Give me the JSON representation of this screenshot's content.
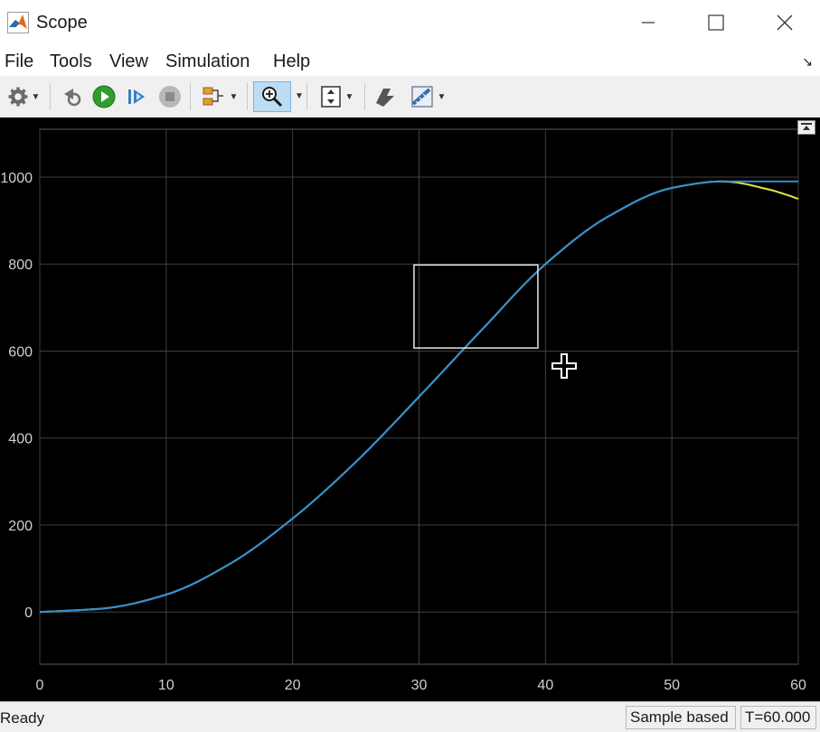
{
  "window": {
    "title": "Scope"
  },
  "menu": {
    "items": [
      "File",
      "Tools",
      "View",
      "Simulation",
      "Help"
    ]
  },
  "toolbar": {
    "icons": [
      "gear-icon",
      "step-back-icon",
      "run-icon",
      "step-forward-icon",
      "stop-icon",
      "signal-select-icon",
      "zoom-in-icon",
      "autoscale-icon",
      "highlight-icon",
      "measure-icon"
    ],
    "zoom_active": true
  },
  "status": {
    "left": "Ready",
    "mode": "Sample based",
    "time": "T=60.000"
  },
  "colors": {
    "plot_bg": "#000000",
    "grid": "#404040",
    "axis_text": "#d0d0d0",
    "series_blue": "#2f8fd8",
    "series_yellow": "#e2e24a",
    "zoom_box": "#d8d8d8"
  },
  "chart_data": {
    "type": "line",
    "title": "",
    "xlabel": "",
    "ylabel": "",
    "xlim": [
      0,
      60
    ],
    "ylim": [
      -120,
      1110
    ],
    "xticks": [
      0,
      10,
      20,
      30,
      40,
      50,
      60
    ],
    "yticks": [
      0,
      200,
      400,
      600,
      800,
      1000
    ],
    "grid": true,
    "series": [
      {
        "color": "#e2e24a",
        "x": [
          0,
          5,
          10,
          15,
          20,
          25,
          30,
          35,
          40,
          45,
          50,
          54,
          55,
          56,
          57,
          58,
          59,
          60
        ],
        "y": [
          0,
          8,
          40,
          110,
          215,
          345,
          495,
          650,
          800,
          910,
          975,
          990,
          988,
          983,
          976,
          969,
          960,
          950
        ]
      },
      {
        "color": "#2f8fd8",
        "x": [
          0,
          5,
          10,
          15,
          20,
          25,
          30,
          35,
          40,
          45,
          50,
          54,
          55,
          60
        ],
        "y": [
          0,
          8,
          40,
          110,
          215,
          345,
          495,
          650,
          800,
          910,
          975,
          990,
          990,
          990
        ]
      }
    ],
    "zoom_box": {
      "x": [
        29.6,
        39.4
      ],
      "y": [
        607,
        798
      ]
    }
  }
}
